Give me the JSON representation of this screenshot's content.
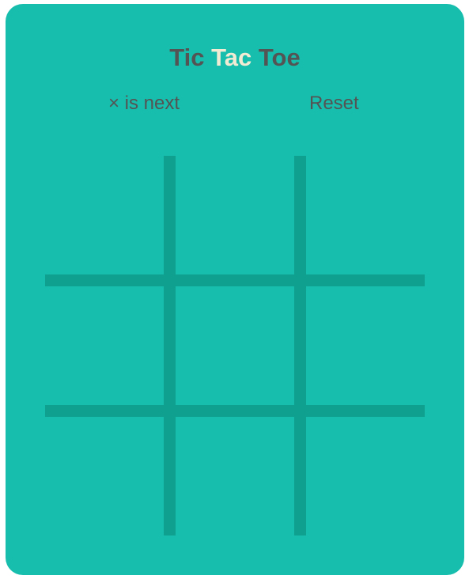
{
  "game": {
    "title_part1": "Tic",
    "title_accent": "Tac",
    "title_part2": "Toe",
    "status": "× is next",
    "reset_label": "Reset",
    "board": [
      "",
      "",
      "",
      "",
      "",
      "",
      "",
      "",
      ""
    ]
  },
  "colors": {
    "background": "#17bead",
    "grid": "#0fa08f",
    "text": "#545454",
    "accent": "#f2ebd3"
  }
}
